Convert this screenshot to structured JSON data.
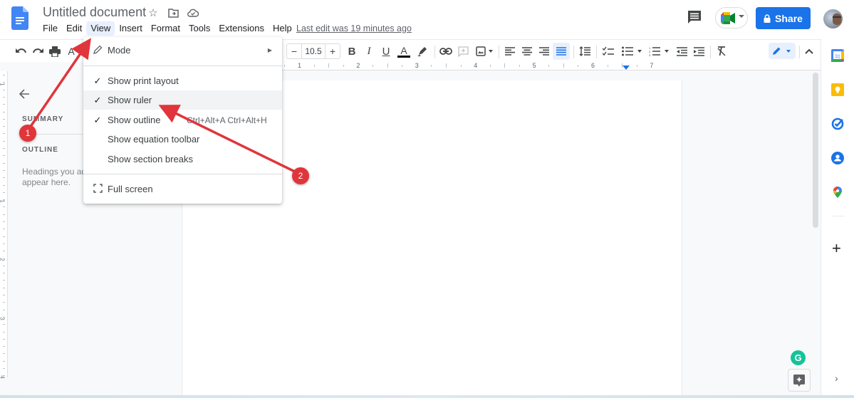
{
  "header": {
    "doc_title": "Untitled document",
    "title_icons": [
      "star-icon",
      "move-to-folder-icon",
      "cloud-saved-icon"
    ],
    "menu": [
      "File",
      "Edit",
      "View",
      "Insert",
      "Format",
      "Tools",
      "Extensions",
      "Help"
    ],
    "active_menu": "View",
    "last_edit": "Last edit was 19 minutes ago",
    "share_label": "Share",
    "accent_color": "#1a73e8"
  },
  "toolbar": {
    "font_size": "10.5",
    "minus": "−",
    "plus": "+",
    "bold": "B",
    "italic": "I",
    "underline": "U",
    "text_color": "A",
    "spellcheck_partial": "A"
  },
  "ruler": {
    "numbers": [
      "1",
      "2",
      "3",
      "4",
      "5",
      "6",
      "7"
    ]
  },
  "vertical_ruler": {
    "numbers": [
      "1",
      "1",
      "2",
      "3",
      "4"
    ]
  },
  "outline_panel": {
    "summary_heading": "SUMMARY",
    "outline_heading": "OUTLINE",
    "hint": "Headings you add to the document will appear here.",
    "hint_line1": "Headings you add",
    "hint_line2": "appear here."
  },
  "view_menu": {
    "items": [
      {
        "label": "Mode",
        "checked": false,
        "icon": "pencil-icon",
        "submenu": true
      },
      {
        "label": "Show print layout",
        "checked": true
      },
      {
        "label": "Show ruler",
        "checked": true,
        "highlighted": true
      },
      {
        "label": "Show outline",
        "checked": true,
        "shortcut": "Ctrl+Alt+A Ctrl+Alt+H"
      },
      {
        "label": "Show equation toolbar",
        "checked": false
      },
      {
        "label": "Show section breaks",
        "checked": false
      },
      {
        "label": "Full screen",
        "checked": false,
        "icon": "fullscreen-icon"
      }
    ],
    "shortcut_visible": "Ctrl+Alt+A Ctrl+Alt+H",
    "check_glyph": "✓"
  },
  "annotations": {
    "badge1": "1",
    "badge2": "2",
    "color": "#e0353b"
  },
  "side_panel": {
    "apps": [
      "calendar-icon",
      "keep-icon",
      "tasks-icon",
      "contacts-icon",
      "maps-icon"
    ],
    "add_label": "+",
    "expand_label": "›"
  },
  "grammarly_label": "G"
}
